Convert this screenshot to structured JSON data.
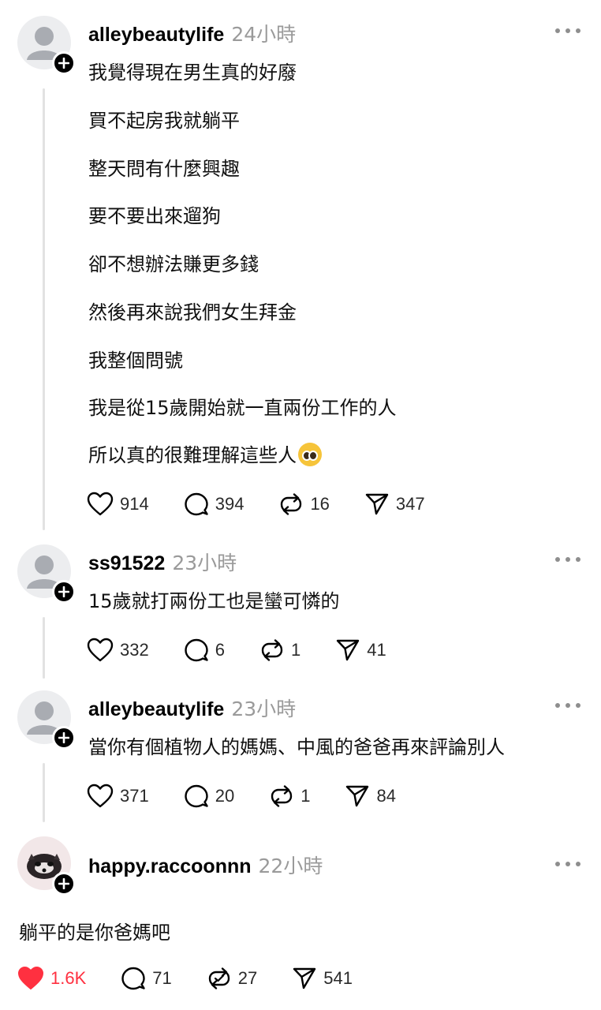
{
  "posts": [
    {
      "username": "alleybeautylife",
      "time": "24小時",
      "lines": [
        "我覺得現在男生真的好廢",
        "買不起房我就躺平",
        "整天問有什麼興趣",
        "要不要出來遛狗",
        "卻不想辦法賺更多錢",
        "然後再來說我們女生拜金",
        "我整個問號",
        "我是從15歲開始就一直兩份工作的人",
        "所以真的很難理解這些人"
      ],
      "likes": "914",
      "comments": "394",
      "reposts": "16",
      "shares": "347"
    },
    {
      "username": "ss91522",
      "time": "23小時",
      "lines": [
        "15歲就打兩份工也是蠻可憐的"
      ],
      "likes": "332",
      "comments": "6",
      "reposts": "1",
      "shares": "41"
    },
    {
      "username": "alleybeautylife",
      "time": "23小時",
      "lines": [
        "當你有個植物人的媽媽、中風的爸爸再來評論別人"
      ],
      "likes": "371",
      "comments": "20",
      "reposts": "1",
      "shares": "84"
    },
    {
      "username": "happy.raccoonnn",
      "time": "22小時",
      "lines": [
        "躺平的是你爸媽吧"
      ],
      "likes": "1.6K",
      "comments": "71",
      "reposts": "27",
      "shares": "541"
    }
  ],
  "icons": {
    "like": "heart-icon",
    "liked": "heart-filled-icon",
    "comment": "comment-bubble-icon",
    "repost": "repost-icon",
    "share": "send-icon",
    "more": "more-dots-icon",
    "follow": "plus-icon"
  },
  "colors": {
    "liked": "#ff3040",
    "muted": "#9a9a9a",
    "thread_line": "#e2e2e2"
  }
}
